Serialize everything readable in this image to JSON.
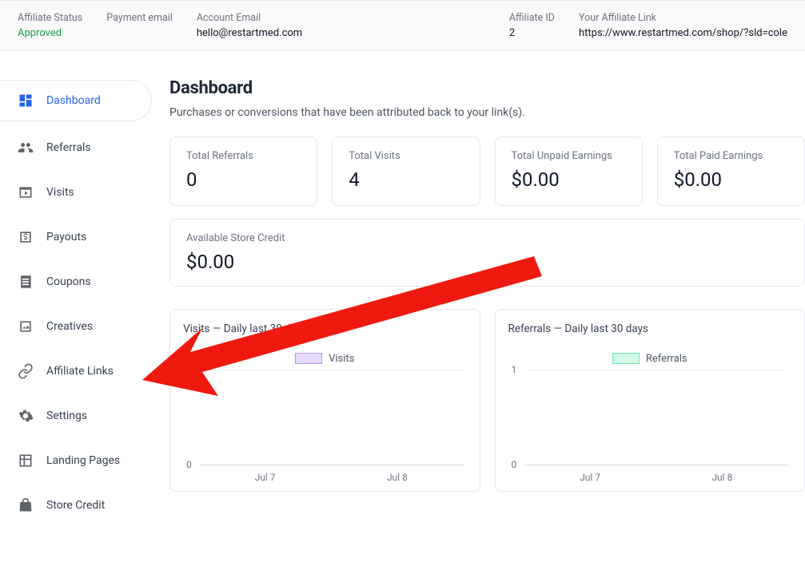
{
  "header": {
    "status_label": "Affiliate Status",
    "status_value": "Approved",
    "payment_email_label": "Payment email",
    "account_email_label": "Account Email",
    "account_email_value": "hello@restartmed.com",
    "affiliate_id_label": "Affiliate ID",
    "affiliate_id_value": "2",
    "affiliate_link_label": "Your Affiliate Link",
    "affiliate_link_value": "https://www.restartmed.com/shop/?sld=cole"
  },
  "sidebar": {
    "items": [
      {
        "label": "Dashboard"
      },
      {
        "label": "Referrals"
      },
      {
        "label": "Visits"
      },
      {
        "label": "Payouts"
      },
      {
        "label": "Coupons"
      },
      {
        "label": "Creatives"
      },
      {
        "label": "Affiliate Links"
      },
      {
        "label": "Settings"
      },
      {
        "label": "Landing Pages"
      },
      {
        "label": "Store Credit"
      }
    ]
  },
  "main": {
    "title": "Dashboard",
    "subtitle": "Purchases or conversions that have been attributed back to your link(s).",
    "kpis": [
      {
        "label": "Total Referrals",
        "value": "0"
      },
      {
        "label": "Total Visits",
        "value": "4"
      },
      {
        "label": "Total Unpaid Earnings",
        "value": "$0.00"
      },
      {
        "label": "Total Paid Earnings",
        "value": "$0.00"
      }
    ],
    "credit_label": "Available Store Credit",
    "credit_value": "$0.00",
    "chart_a_title": "Visits — Daily last 30 days",
    "chart_a_legend": "Visits",
    "chart_b_title": "Referrals — Daily last 30 days",
    "chart_b_legend": "Referrals"
  },
  "chart_data": [
    {
      "type": "line",
      "title": "Visits — Daily last 30 days",
      "categories": [
        "Jul 7",
        "Jul 8"
      ],
      "series": [
        {
          "name": "Visits",
          "values": [
            0,
            0
          ]
        }
      ],
      "ylim": [
        0,
        1
      ],
      "yticks": [
        0,
        1
      ],
      "ylabel": "",
      "xlabel": ""
    },
    {
      "type": "line",
      "title": "Referrals — Daily last 30 days",
      "categories": [
        "Jul 7",
        "Jul 8"
      ],
      "series": [
        {
          "name": "Referrals",
          "values": [
            0,
            0
          ]
        }
      ],
      "ylim": [
        0,
        1
      ],
      "yticks": [
        0,
        1
      ],
      "ylabel": "",
      "xlabel": ""
    }
  ]
}
